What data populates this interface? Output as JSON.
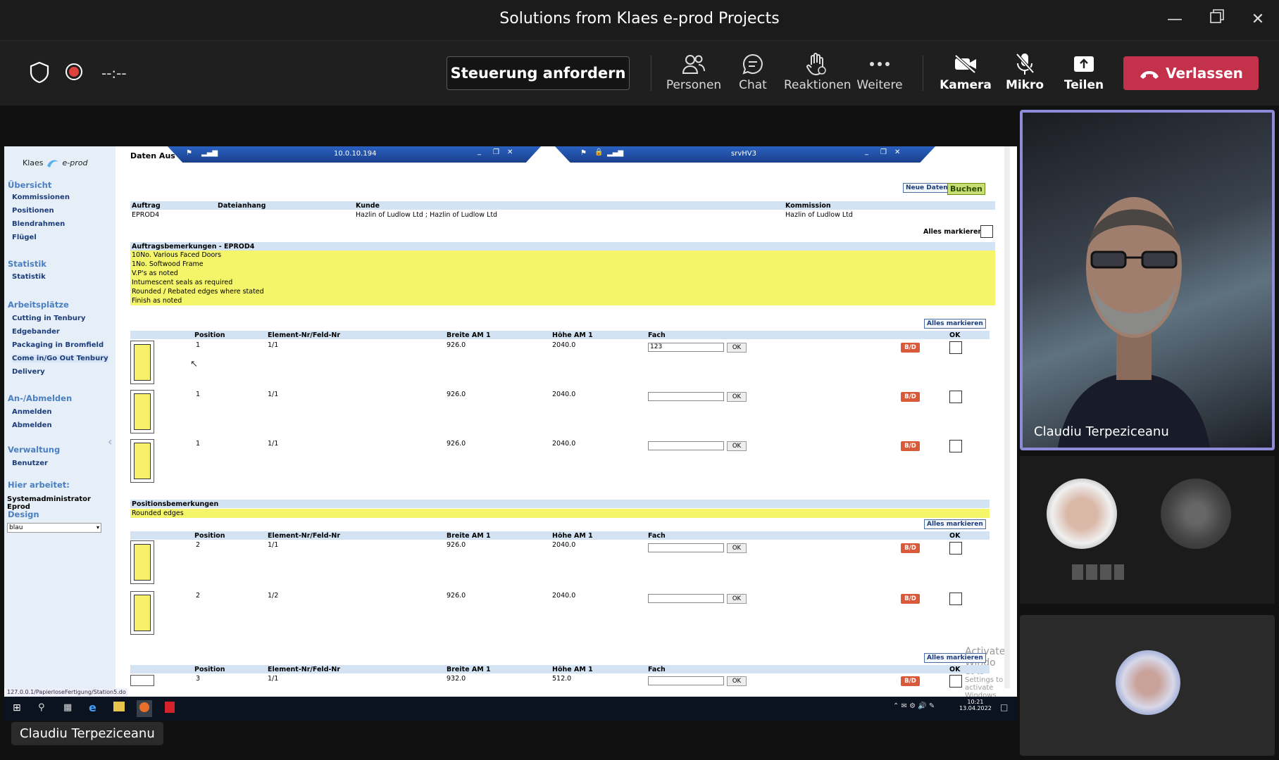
{
  "window": {
    "title": "Solutions from Klaes e-prod Projects"
  },
  "toolbar": {
    "timer": "--:--",
    "request_control": "Steuerung anfordern",
    "tools": [
      {
        "label": "Personen",
        "icon": "people-icon"
      },
      {
        "label": "Chat",
        "icon": "chat-icon"
      },
      {
        "label": "Reaktionen",
        "icon": "raise-hand-icon"
      },
      {
        "label": "Weitere",
        "icon": "more-icon"
      },
      {
        "label": "Kamera",
        "icon": "camera-off-icon"
      },
      {
        "label": "Mikro",
        "icon": "mic-off-icon"
      },
      {
        "label": "Teilen",
        "icon": "share-icon"
      }
    ],
    "leave": "Verlassen"
  },
  "shared": {
    "rdp_tabs": [
      {
        "label": "10.0.10.194"
      },
      {
        "label": "srvHV3"
      }
    ],
    "header_label": "Daten Aus",
    "logo": {
      "brand1": "Klaes",
      "brand2": "e-prod"
    },
    "sidebar": {
      "sections": [
        {
          "title": "Übersicht",
          "items": [
            "Kommissionen",
            "Positionen",
            "Blendrahmen",
            "Flügel"
          ]
        },
        {
          "title": "Statistik",
          "items": [
            "Statistik"
          ]
        },
        {
          "title": "Arbeitsplätze",
          "items": [
            "Cutting in Tenbury",
            "Edgebander",
            "Packaging in Bromfield",
            "Come in/Go Out Tenbury",
            "Delivery"
          ]
        },
        {
          "title": "An-/Abmelden",
          "items": [
            "Anmelden",
            "Abmelden"
          ]
        },
        {
          "title": "Verwaltung",
          "items": [
            "Benutzer"
          ]
        }
      ],
      "working_label": "Hier arbeitet:",
      "working_user": "Systemadministrator Eprod",
      "design_label": "Design",
      "design_value": "blau"
    },
    "buttons": {
      "new_data": "Neue Daten",
      "book": "Buchen",
      "mark_all": "Alles markieren"
    },
    "order": {
      "headers": [
        "Auftrag",
        "Dateianhang",
        "Kunde",
        "Kommission"
      ],
      "values": [
        "EPROD4",
        "",
        "Hazlin of Ludlow Ltd ; Hazlin of Ludlow Ltd",
        "Hazlin of Ludlow Ltd"
      ]
    },
    "order_remarks": {
      "title": "Auftragsbemerkungen - EPROD4",
      "lines": [
        "10No. Various Faced Doors",
        "1No. Softwood Frame",
        "V.P's as noted",
        "Intumescent seals as required",
        "Rounded / Rebated edges where stated",
        "Finish as noted"
      ]
    },
    "position_remarks": {
      "title": "Positionsbemerkungen",
      "lines": [
        "Rounded edges"
      ]
    },
    "columns": [
      "Position",
      "Element-Nr/Feld-Nr",
      "Breite AM 1",
      "Höhe AM 1",
      "Fach",
      "OK"
    ],
    "groups": [
      {
        "rows": [
          {
            "position": "1",
            "element": "1/1",
            "width": "926.0",
            "height": "2040.0",
            "fach": "123",
            "ok": "OK",
            "bd": "B/D"
          },
          {
            "position": "1",
            "element": "1/1",
            "width": "926.0",
            "height": "2040.0",
            "fach": "",
            "ok": "OK",
            "bd": "B/D"
          },
          {
            "position": "1",
            "element": "1/1",
            "width": "926.0",
            "height": "2040.0",
            "fach": "",
            "ok": "OK",
            "bd": "B/D"
          }
        ]
      },
      {
        "rows": [
          {
            "position": "2",
            "element": "1/1",
            "width": "926.0",
            "height": "2040.0",
            "fach": "",
            "ok": "OK",
            "bd": "B/D"
          },
          {
            "position": "2",
            "element": "1/2",
            "width": "926.0",
            "height": "2040.0",
            "fach": "",
            "ok": "OK",
            "bd": "B/D"
          }
        ]
      },
      {
        "rows": [
          {
            "position": "3",
            "element": "1/1",
            "width": "932.0",
            "height": "512.0",
            "fach": "",
            "ok": "OK",
            "bd": "B/D"
          }
        ]
      }
    ],
    "status_url": "127.0.0.1/PapierloseFertigung/Station5.do",
    "activate": {
      "line1": "Activate Windo",
      "line2": "Go to Settings to activate Windows."
    },
    "taskbar": {
      "time": "10:21",
      "date": "13.04.2022"
    }
  },
  "presenter_name": "Claudiu Terpeziceanu",
  "video": {
    "name": "Claudiu Terpeziceanu"
  }
}
